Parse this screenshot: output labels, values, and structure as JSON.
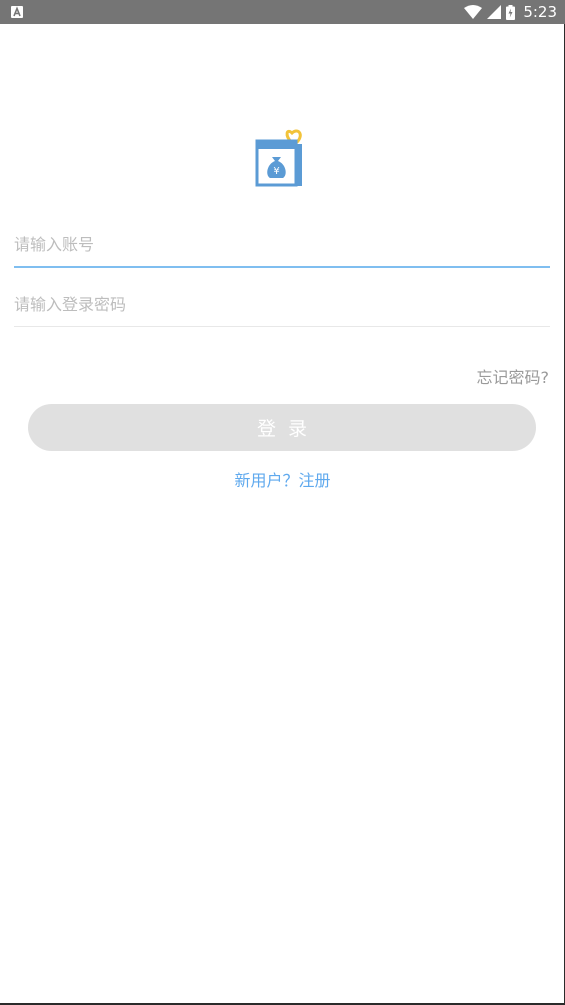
{
  "status_bar": {
    "time": "5:23",
    "notification_icon": "android-a-icon",
    "wifi_icon": "wifi-icon",
    "signal_icon": "cell-signal-icon",
    "battery_icon": "battery-charging-icon"
  },
  "logo": {
    "icon": "money-bag-yuan-logo",
    "colors": {
      "blue": "#5b9bd5",
      "heart": "#f2c33a"
    }
  },
  "login_form": {
    "account_placeholder": "请输入账号",
    "password_placeholder": "请输入登录密码",
    "forgot_password": "忘记密码?",
    "login_button": "登录",
    "register_link": "新用户？注册"
  },
  "colors": {
    "status_bar": "#757575",
    "accent_blue": "#5fa9ee",
    "active_underline": "#7fbef0",
    "button_disabled": "#e0e0e0",
    "muted_text": "#9a9a9a"
  }
}
